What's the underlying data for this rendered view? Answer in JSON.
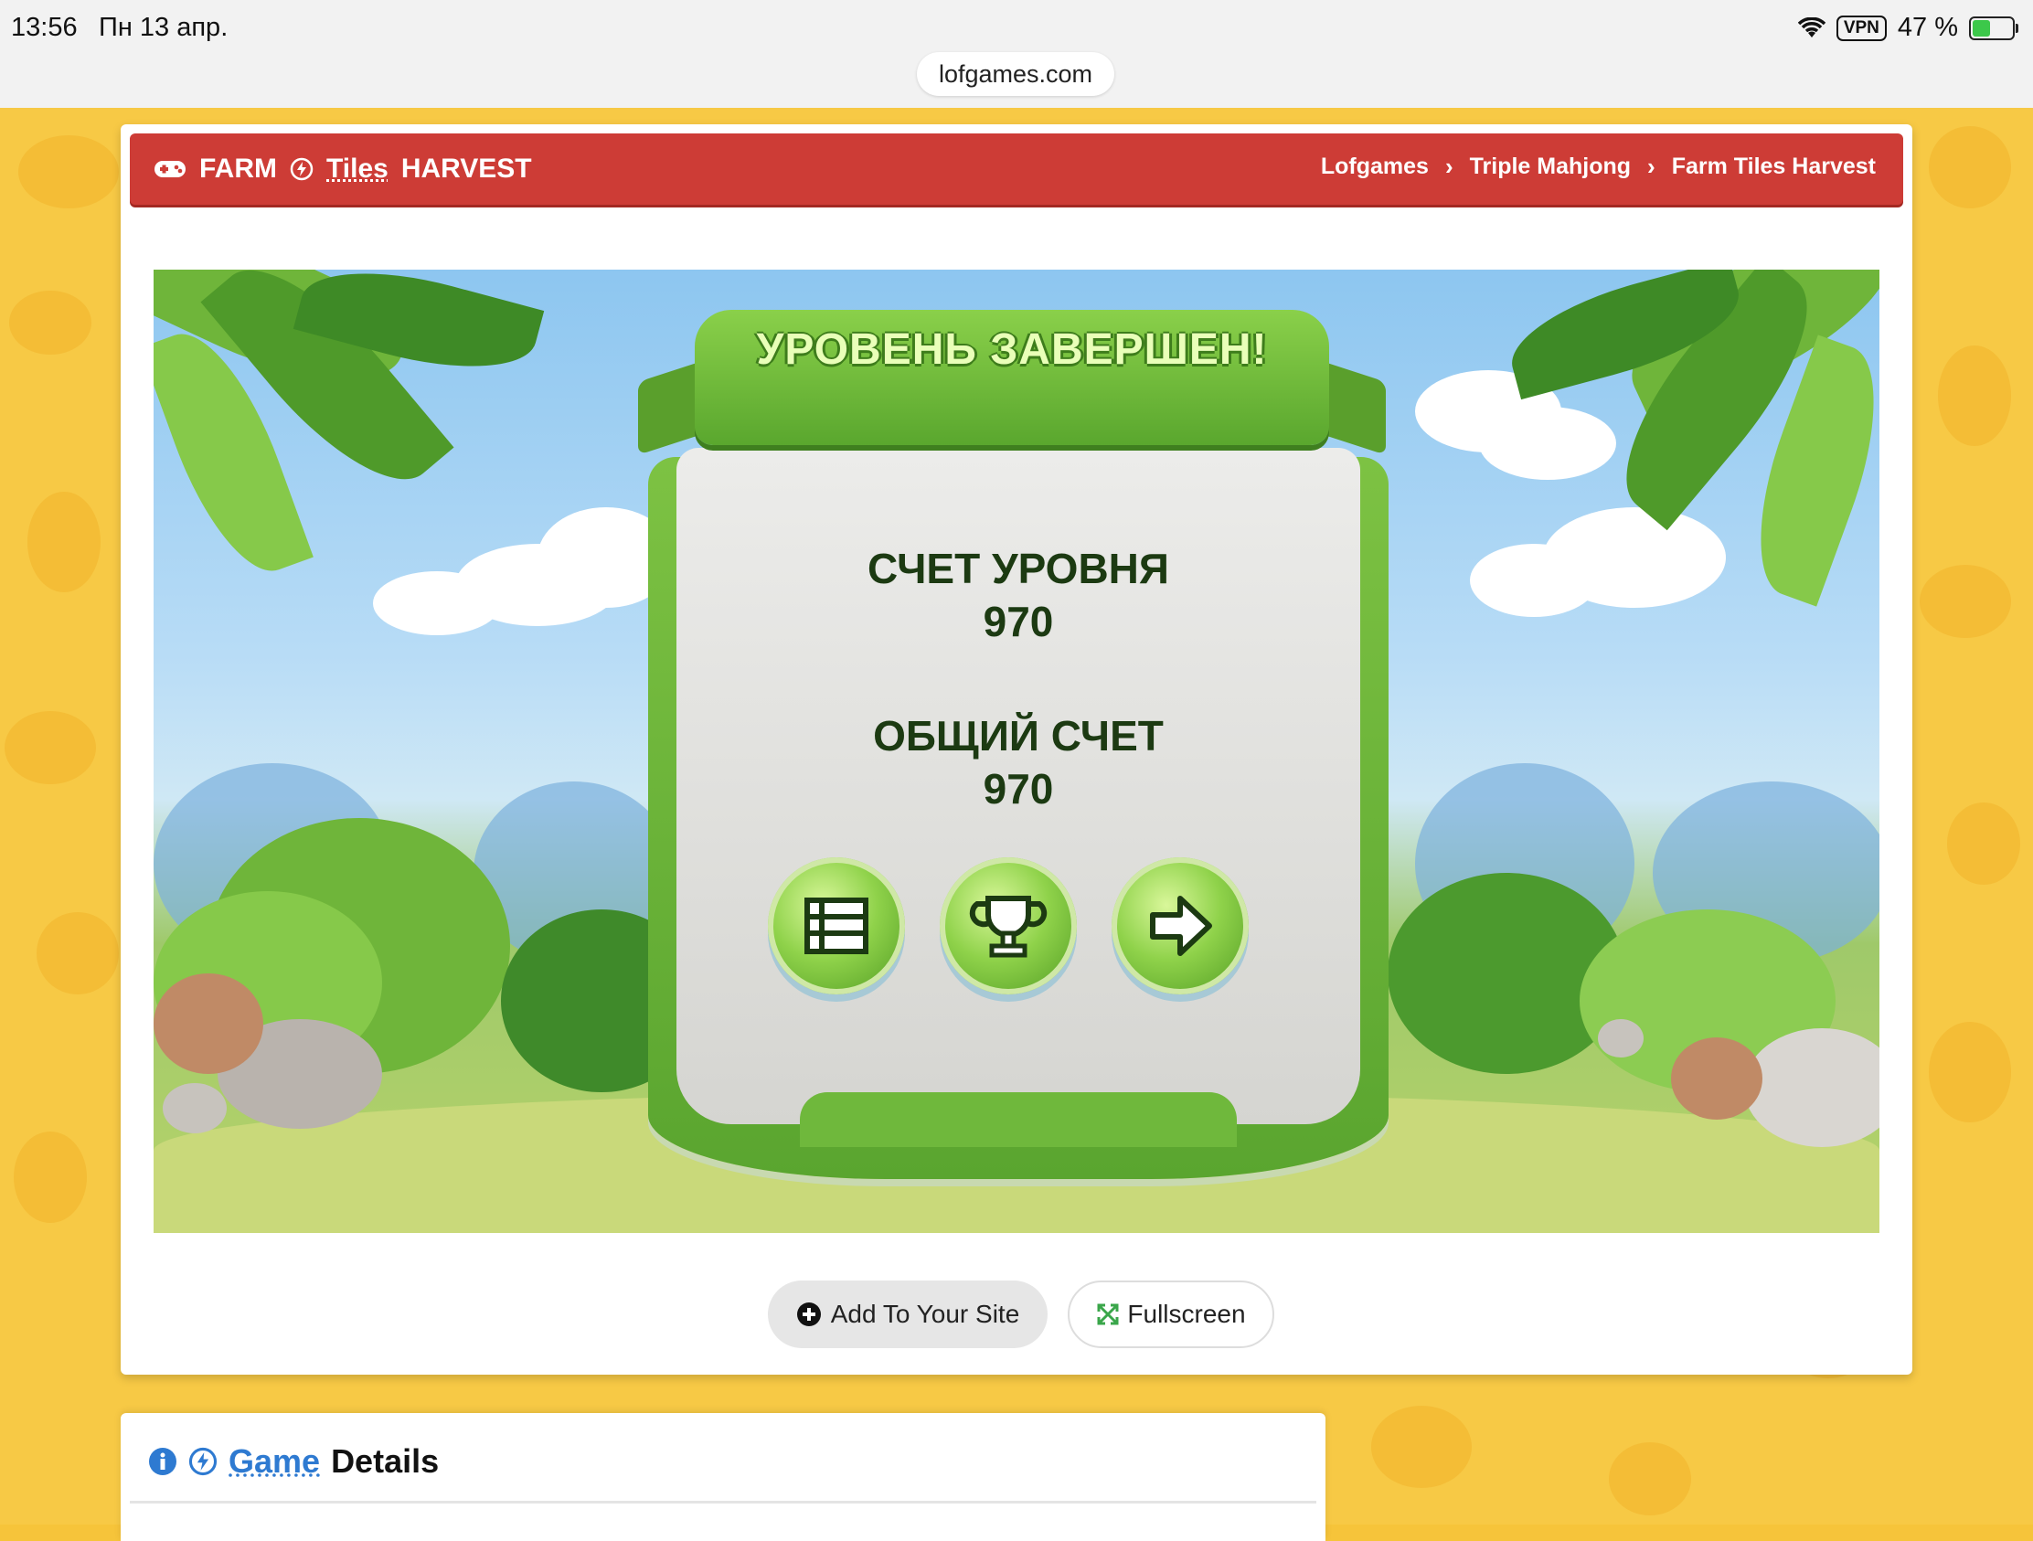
{
  "status_bar": {
    "time": "13:56",
    "date": "Пн 13 апр.",
    "vpn": "VPN",
    "battery": "47 %",
    "battery_level": 0.47
  },
  "browser": {
    "url": "lofgames.com"
  },
  "header": {
    "brand_part1": "FARM",
    "brand_link": "Tiles",
    "brand_part2": "HARVEST",
    "breadcrumb": [
      "Lofgames",
      "Triple Mahjong",
      "Farm Tiles Harvest"
    ]
  },
  "game": {
    "title": "УРОВЕНЬ ЗАВЕРШЕН!",
    "level_score_label": "СЧЕТ УРОВНЯ",
    "level_score": "970",
    "total_score_label": "ОБЩИЙ СЧЕТ",
    "total_score": "970",
    "buttons": [
      "menu-icon",
      "trophy-icon",
      "next-arrow-icon"
    ]
  },
  "actions": {
    "add_to_site": "Add To Your Site",
    "fullscreen": "Fullscreen"
  },
  "details": {
    "title_link": "Game",
    "title_rest": "Details"
  },
  "colors": {
    "header_red": "#cd3c36",
    "panel_green": "#6fb83c",
    "page_yellow": "#f7c945",
    "link_blue": "#2e7ad1"
  }
}
